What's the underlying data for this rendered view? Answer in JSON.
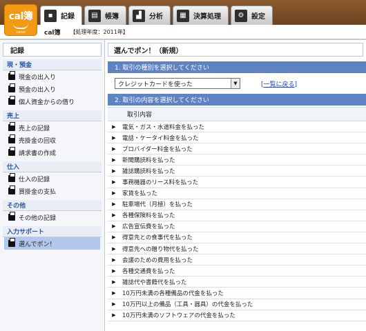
{
  "logo": {
    "text": "cal簿",
    "sub": "calvo"
  },
  "tabs": [
    {
      "label": "記録",
      "icon": "book-icon",
      "active": true
    },
    {
      "label": "帳簿",
      "icon": "ledger-icon",
      "active": false
    },
    {
      "label": "分析",
      "icon": "chart-icon",
      "active": false
    },
    {
      "label": "決算処理",
      "icon": "settlement-icon",
      "active": false
    },
    {
      "label": "設定",
      "icon": "gear-icon",
      "active": false
    }
  ],
  "subheader": {
    "app_name": "cal簿",
    "fiscal_year": "【処理年度：2011年】"
  },
  "sidebar": {
    "title": "記録",
    "sections": [
      {
        "label": "現・預金",
        "items": [
          "現金の出入り",
          "預金の出入り",
          "個人資金からの借り"
        ]
      },
      {
        "label": "売上",
        "items": [
          "売上の記録",
          "売掛金の回収",
          "請求書の作成"
        ]
      },
      {
        "label": "仕入",
        "items": [
          "仕入の記録",
          "買掛金の支払"
        ]
      },
      {
        "label": "その他",
        "items": [
          "その他の記録"
        ]
      },
      {
        "label": "入力サポート",
        "items": [
          "選んでポン！"
        ]
      }
    ]
  },
  "main": {
    "title": "選んでポン！（新規）",
    "step1": "1. 取引の種別を選択してください",
    "select_value": "クレジットカードを使った",
    "back_link": "[一覧に戻る]",
    "step2": "2. 取引の内容を選択してください",
    "column_header": "取引内容",
    "rows": [
      "電気・ガス・水道料金を払った",
      "電話・ケータイ料金を払った",
      "プロバイダー料金を払った",
      "新聞購読料を払った",
      "雑誌購読料を払った",
      "事務機器のリース料を払った",
      "家賃を払った",
      "駐車場代（月極）を払った",
      "各種保険料を払った",
      "広告宣伝費を払った",
      "得意先との食事代を払った",
      "得意先への贈り物代を払った",
      "会議のための費用を払った",
      "各種交通費を払った",
      "雑誌代や書籍代を払った",
      "10万円未満の各種備品の代金を払った",
      "10万円以上の備品（工具・器具）の代金を払った",
      "10万円未満のソフトウェアの代金を払った"
    ]
  },
  "colors": {
    "brand": "#f39a15",
    "header_bar": "#7a4b24",
    "step_bar": "#5f82c2",
    "active_item": "#b3c7ec"
  }
}
